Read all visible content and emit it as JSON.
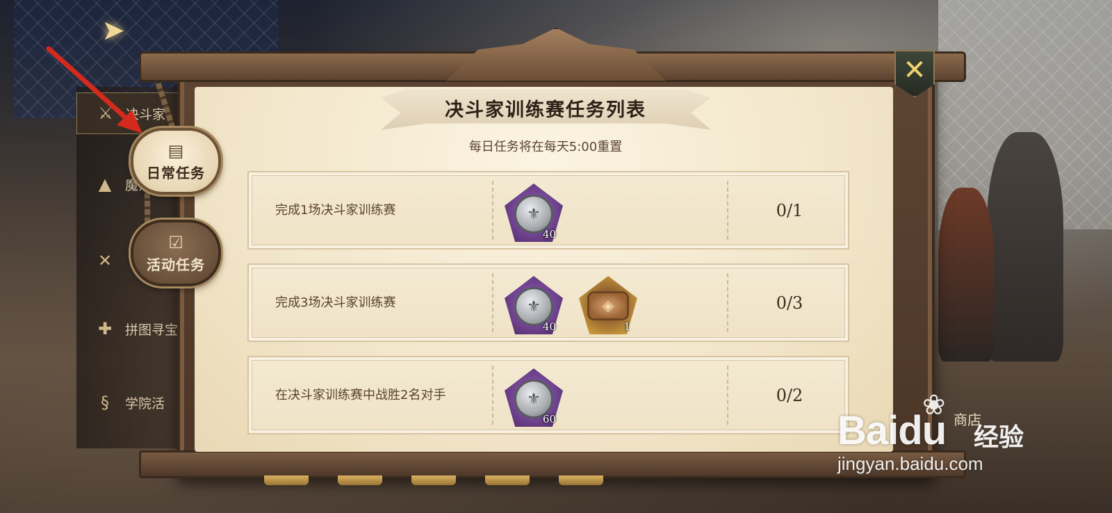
{
  "panel": {
    "title": "决斗家训练赛任务列表",
    "subtitle": "每日任务将在每天5:00重置"
  },
  "tabs": [
    {
      "label": "日常任务",
      "icon": "scroll-list-icon",
      "active": true
    },
    {
      "label": "活动任务",
      "icon": "clipboard-check-icon",
      "active": false
    }
  ],
  "sidebar": {
    "items": [
      {
        "label": "决斗家",
        "icon": "wand-icon"
      },
      {
        "label": "魔法",
        "icon": "witch-hat-icon"
      },
      {
        "label": "",
        "icon": "map-icon"
      },
      {
        "label": "拼图寻宝",
        "icon": "puzzle-icon"
      },
      {
        "label": "学院活",
        "icon": "scroll-icon"
      }
    ]
  },
  "tasks": [
    {
      "description": "完成1场决斗家训练赛",
      "rewards": [
        {
          "type": "silver-badge",
          "icon": "duel-coin-icon",
          "quantity": "40"
        }
      ],
      "progress": "0/1"
    },
    {
      "description": "完成3场决斗家训练赛",
      "rewards": [
        {
          "type": "silver-badge",
          "icon": "duel-coin-icon",
          "quantity": "40"
        },
        {
          "type": "gold-badge",
          "icon": "ticket-icon",
          "quantity": "1"
        }
      ],
      "progress": "0/3"
    },
    {
      "description": "在决斗家训练赛中战胜2名对手",
      "rewards": [
        {
          "type": "silver-badge",
          "icon": "duel-coin-icon",
          "quantity": "60"
        }
      ],
      "progress": "0/2"
    }
  ],
  "watermark": {
    "logo": "Bai",
    "logo_du": "du",
    "brand_suffix": "经验",
    "url": "jingyan.baidu.com",
    "partial_label": "商店"
  },
  "colors": {
    "parchment": "#f3e7cc",
    "frame": "#5e4533",
    "gold_accent": "#f0d36e",
    "annotation_arrow": "#d42a1e"
  }
}
